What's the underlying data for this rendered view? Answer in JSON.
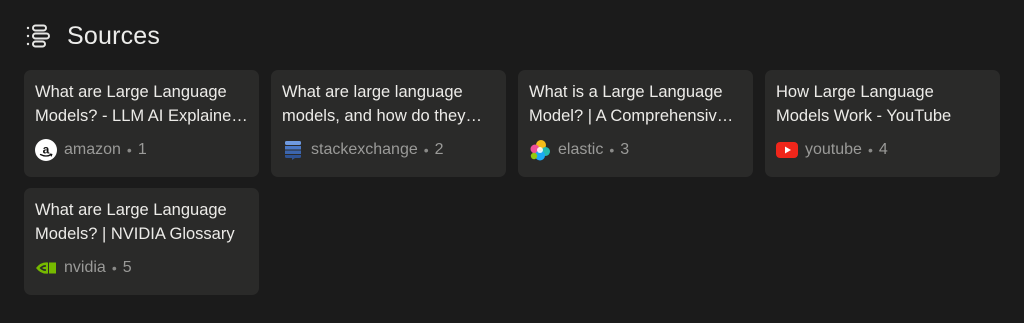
{
  "header": {
    "title": "Sources",
    "icon": "sources-list-icon"
  },
  "sources": [
    {
      "title": "What are Large Language Models? - LLM AI Explained - AWS",
      "site": "amazon",
      "index": "1",
      "icon": "amazon-favicon-icon"
    },
    {
      "title": "What are large language models, and how do they work?",
      "site": "stackexchange",
      "index": "2",
      "icon": "stackexchange-favicon-icon"
    },
    {
      "title": "What is a Large Language Model? | A Comprehensive LLMs Guide",
      "site": "elastic",
      "index": "3",
      "icon": "elastic-favicon-icon"
    },
    {
      "title": "How Large Language Models Work - YouTube",
      "site": "youtube",
      "index": "4",
      "icon": "youtube-favicon-icon"
    },
    {
      "title": "What are Large Language Models? | NVIDIA Glossary",
      "site": "nvidia",
      "index": "5",
      "icon": "nvidia-favicon-icon"
    }
  ],
  "colors": {
    "background": "#1b1b1b",
    "card": "#2a2a29",
    "title_text": "#ecebe8",
    "meta_text": "#9a9a98"
  }
}
